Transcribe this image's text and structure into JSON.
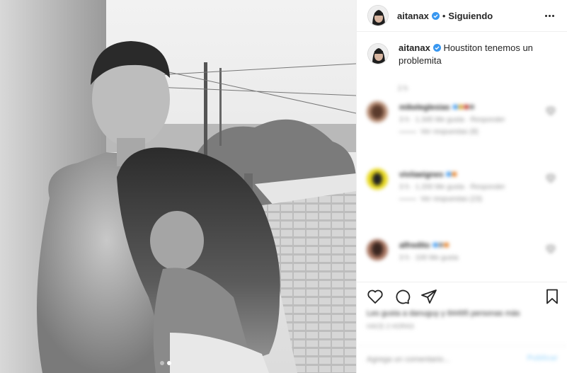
{
  "post": {
    "username": "aitanax",
    "verified": true,
    "separator": "•",
    "follow_status": "Siguiendo",
    "caption": "Houstiton tenemos un problemita",
    "time_ago": "2 h",
    "carousel": {
      "total": 2,
      "active": 2
    }
  },
  "comments": [
    {
      "name": "mikeleglesias",
      "text": "",
      "meta": "3 h · 1.345 Me gusta · Responder",
      "replies": "Ver respuestas (8)"
    },
    {
      "name": "viviiaeignes",
      "text": "",
      "meta": "3 h · 1.200 Me gusta · Responder",
      "replies": "Ver respuestas (23)"
    },
    {
      "name": "alfredito",
      "text": "",
      "meta": "3 h · 100 Me gusta",
      "replies": ""
    }
  ],
  "likes": {
    "text": "Les gusta a danuguy y 84495 personas más",
    "time": "HACE 2 HORAS"
  },
  "add_comment": {
    "placeholder": "Agrega un comentario...",
    "publish_label": "Publicar"
  },
  "icons": {
    "header_more": "more-options-icon",
    "verified": "verified-badge-icon",
    "like": "heart-icon",
    "comment": "comment-icon",
    "share": "share-icon",
    "save": "bookmark-icon"
  },
  "colors": {
    "verified_blue": "#3897f0",
    "publish_disabled": "#b2dffc",
    "meta_grey": "#8e8e8e"
  }
}
